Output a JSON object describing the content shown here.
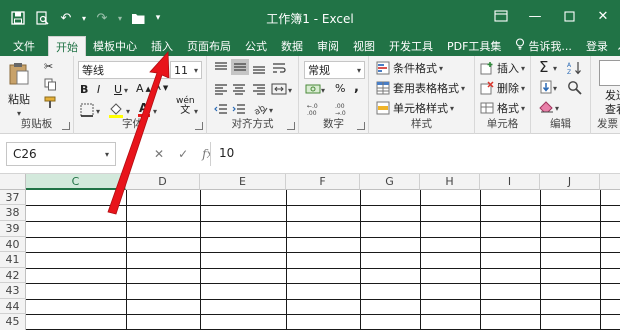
{
  "titlebar": {
    "title": "工作簿1 - Excel",
    "icons": [
      "save-icon",
      "print-preview-icon",
      "undo-icon",
      "redo-icon",
      "folder-icon",
      "customize-qat-icon"
    ],
    "window_controls": [
      "ribbon-display-icon",
      "minimize-icon",
      "maximize-icon",
      "close-icon"
    ]
  },
  "tabs": {
    "items": [
      "文件",
      "开始",
      "模板中心",
      "插入",
      "页面布局",
      "公式",
      "数据",
      "审阅",
      "视图",
      "开发工具",
      "PDF工具集"
    ],
    "active": "开始",
    "tell_me": "告诉我...",
    "login": "登录"
  },
  "ribbon": {
    "clipboard": {
      "paste": "粘贴",
      "label": "剪贴板"
    },
    "font": {
      "name": "等线",
      "size": "11",
      "bold": "B",
      "italic": "I",
      "underline": "U",
      "wen": "wén",
      "label": "字体"
    },
    "alignment": {
      "label": "对齐方式"
    },
    "number": {
      "format": "常规",
      "percent": "%",
      "comma": ",",
      "label": "数字"
    },
    "styles": {
      "conditional": "条件格式",
      "table": "套用表格格式",
      "cell": "单元格样式",
      "label": "样式"
    },
    "cells": {
      "insert": "插入",
      "delete": "删除",
      "format": "格式",
      "label": "单元格"
    },
    "editing": {
      "sum": "Σ",
      "label": "编辑"
    },
    "send": {
      "line1": "发送",
      "line2": "查看",
      "label": "发票"
    }
  },
  "formula_bar": {
    "name_box": "C26",
    "cancel": "✕",
    "enter": "✓",
    "fx": "fx",
    "value": "10"
  },
  "grid": {
    "columns": [
      "C",
      "D",
      "E",
      "F",
      "G",
      "H",
      "I",
      "J"
    ],
    "selected_column": "C",
    "rows": [
      "37",
      "38",
      "39",
      "40",
      "41",
      "42",
      "43",
      "44",
      "45"
    ]
  },
  "annotation": {
    "type": "red-arrow",
    "color": "#e8141b",
    "target": "插入"
  }
}
